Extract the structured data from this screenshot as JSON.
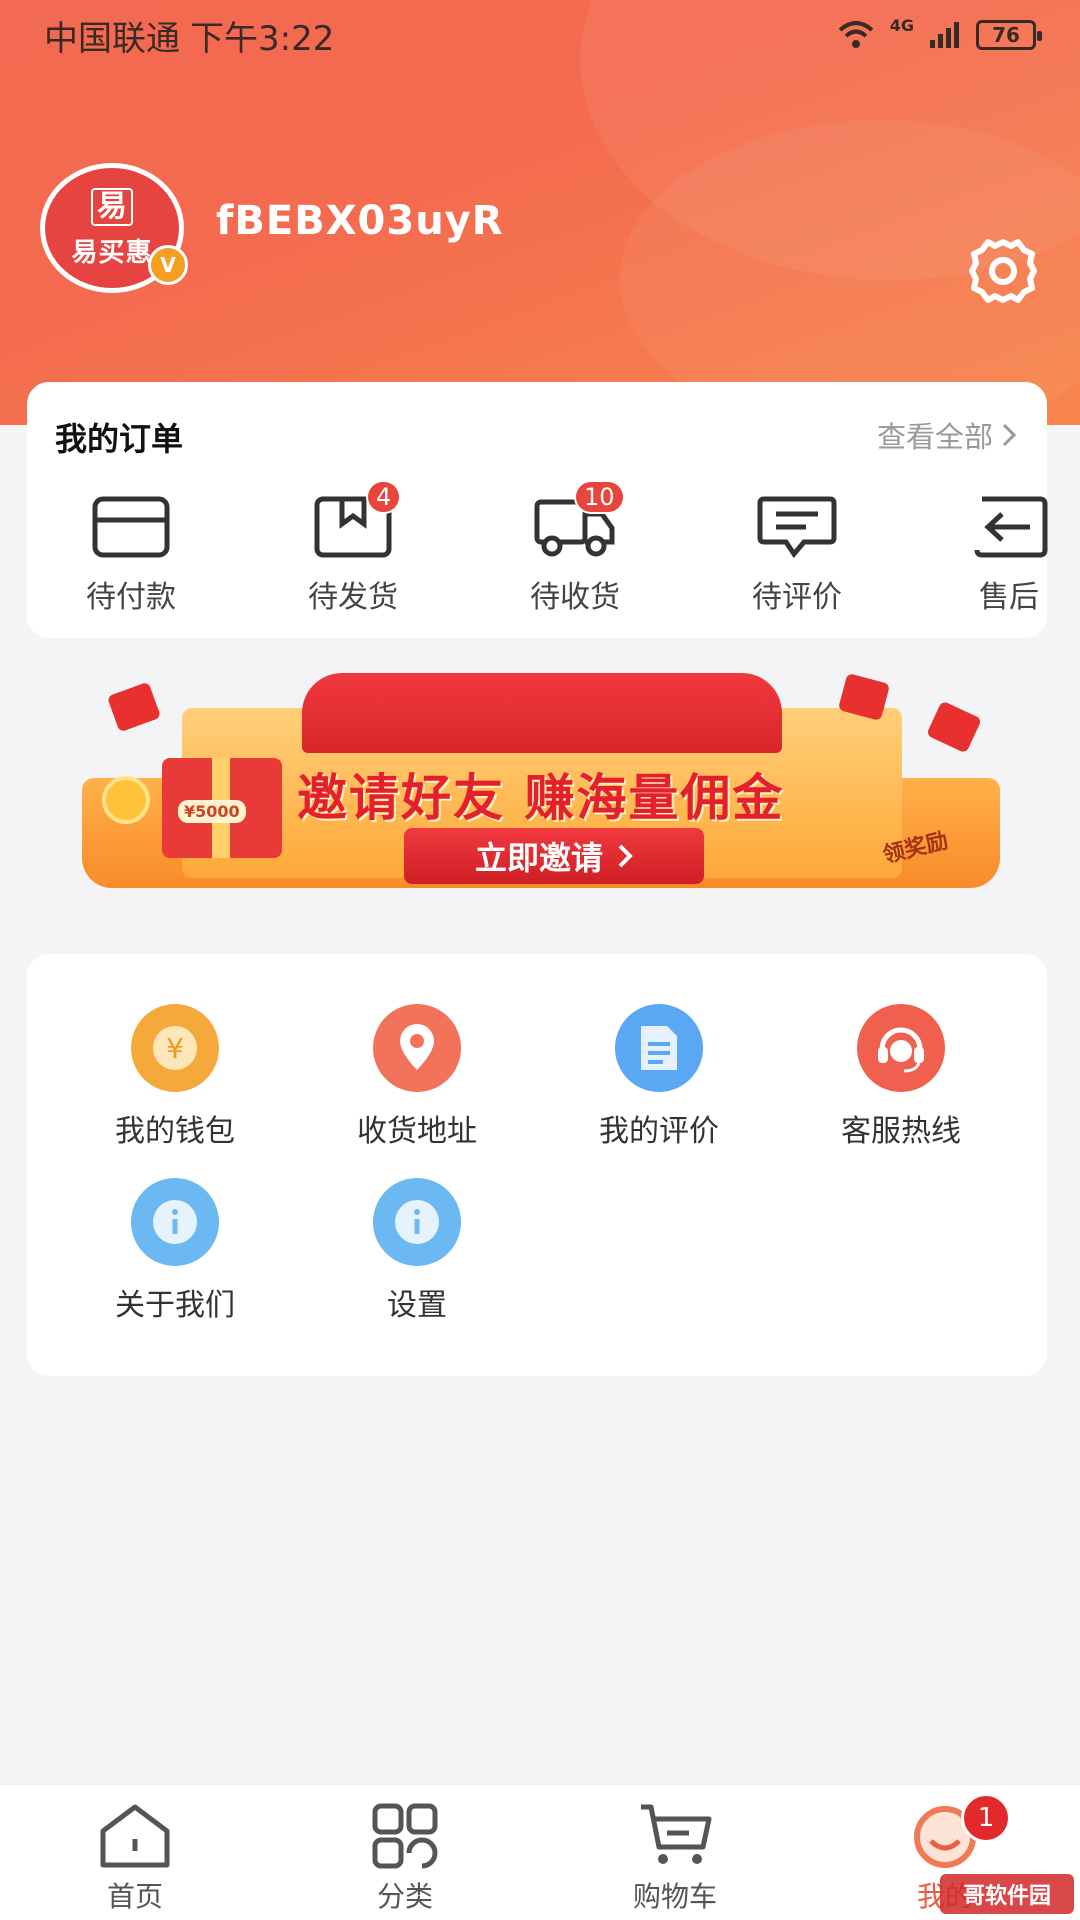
{
  "status_bar": {
    "carrier": "中国联通",
    "time": "下午3:22",
    "network": "4G",
    "battery": "76"
  },
  "profile": {
    "avatar_text_top": "易",
    "avatar_text": "易买惠",
    "badge": "V",
    "username": "fBEBX03uyR",
    "settings_icon": "gear-icon"
  },
  "orders": {
    "title": "我的订单",
    "view_all": "查看全部",
    "items": [
      {
        "label": "待付款",
        "icon": "wallet-card-icon",
        "badge": ""
      },
      {
        "label": "待发货",
        "icon": "package-box-icon",
        "badge": "4"
      },
      {
        "label": "待收货",
        "icon": "delivery-truck-icon",
        "badge": "10"
      },
      {
        "label": "待评价",
        "icon": "comment-icon",
        "badge": ""
      },
      {
        "label": "售后",
        "icon": "return-arrow-icon",
        "badge": ""
      }
    ]
  },
  "banner": {
    "gift_label": "¥5000",
    "headline": "邀请好友  赚海量佣金",
    "button": "立即邀请",
    "reward": "领奖励"
  },
  "services": [
    {
      "label": "我的钱包",
      "icon": "yen-coin-icon",
      "color": "#f6a93b"
    },
    {
      "label": "收货地址",
      "icon": "location-pin-icon",
      "color": "#f2735a"
    },
    {
      "label": "我的评价",
      "icon": "document-icon",
      "color": "#5aa7f3"
    },
    {
      "label": "客服热线",
      "icon": "customer-service-icon",
      "color": "#f0604e"
    },
    {
      "label": "关于我们",
      "icon": "info-icon",
      "color": "#6cb8f2"
    },
    {
      "label": "设置",
      "icon": "info-icon",
      "color": "#6cb8f2"
    }
  ],
  "tabbar": {
    "items": [
      {
        "label": "首页",
        "icon": "home-icon"
      },
      {
        "label": "分类",
        "icon": "category-icon"
      },
      {
        "label": "购物车",
        "icon": "cart-icon"
      },
      {
        "label": "我的",
        "icon": "profile-smile-icon",
        "badge": "1"
      }
    ],
    "active_color": "#ef5b3e"
  },
  "watermark": "哥软件园"
}
